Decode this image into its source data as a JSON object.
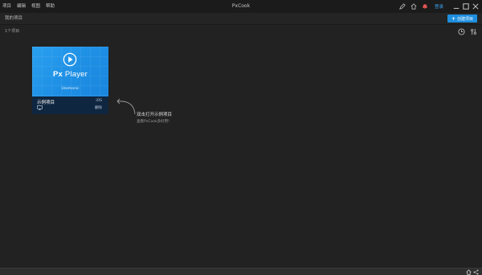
{
  "titlebar": {
    "menu": [
      "项目",
      "编辑",
      "视图",
      "帮助"
    ],
    "app_title": "PxCook",
    "login": "登录",
    "accent": "#1e8ede"
  },
  "toolbar": {
    "section_title": "我的项目",
    "create_label": "创建项目"
  },
  "projects": {
    "count_label": "1个项目",
    "items": [
      {
        "brand_prefix": "Px",
        "brand_name": "Player",
        "thumb_sub": "Usemonic",
        "name": "示例项目",
        "platform": "iOS",
        "delete_label": "删除"
      }
    ]
  },
  "hint": {
    "title": "双击打开示例项目",
    "subtitle": "查看PxCook多好用!"
  },
  "icons": [
    "pen-icon",
    "home-outline-icon",
    "bell-icon",
    "minimize-icon",
    "maximize-icon",
    "close-icon",
    "clock-icon",
    "filter-icon",
    "play-icon",
    "monitor-icon",
    "arrow-icon",
    "home-icon",
    "share-icon"
  ]
}
